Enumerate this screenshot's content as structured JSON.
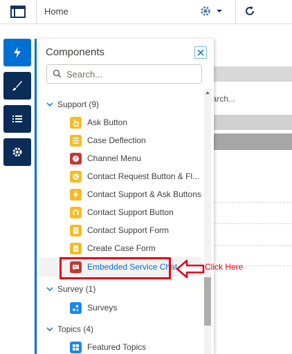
{
  "topbar": {
    "page_name": "Home"
  },
  "canvas": {
    "search_fragment": "earch..."
  },
  "panel": {
    "title": "Components",
    "search_placeholder": "Search...",
    "sections": [
      {
        "label": "Support (9)",
        "items": [
          {
            "label": "Ask Button",
            "icon": "hand-pointer-icon",
            "color": "#f4bc25"
          },
          {
            "label": "Case Deflection",
            "icon": "list-icon",
            "color": "#f4bc25"
          },
          {
            "label": "Channel Menu",
            "icon": "question-icon",
            "color": "#c23934"
          },
          {
            "label": "Contact Request Button & Fl...",
            "icon": "phone-icon",
            "color": "#f4bc25"
          },
          {
            "label": "Contact Support & Ask Buttons",
            "icon": "lightning-icon",
            "color": "#f4bc25"
          },
          {
            "label": "Contact Support Button",
            "icon": "headset-icon",
            "color": "#f4bc25"
          },
          {
            "label": "Contact Support Form",
            "icon": "form-icon",
            "color": "#f4bc25"
          },
          {
            "label": "Create Case Form",
            "icon": "document-icon",
            "color": "#f4bc25"
          },
          {
            "label": "Embedded Service Chat",
            "icon": "chat-icon",
            "color": "#c23934",
            "selected": true
          }
        ]
      },
      {
        "label": "Survey (1)",
        "items": [
          {
            "label": "Surveys",
            "icon": "survey-icon",
            "color": "#1589ee"
          }
        ]
      },
      {
        "label": "Topics (4)",
        "items": [
          {
            "label": "Featured Topics",
            "icon": "grid-icon",
            "color": "#1589ee"
          }
        ]
      }
    ]
  },
  "annotation": {
    "label": "Click Here",
    "color": "#e0001b"
  },
  "colors": {
    "brand": "#0070d2",
    "rail": "#0b2c57"
  }
}
